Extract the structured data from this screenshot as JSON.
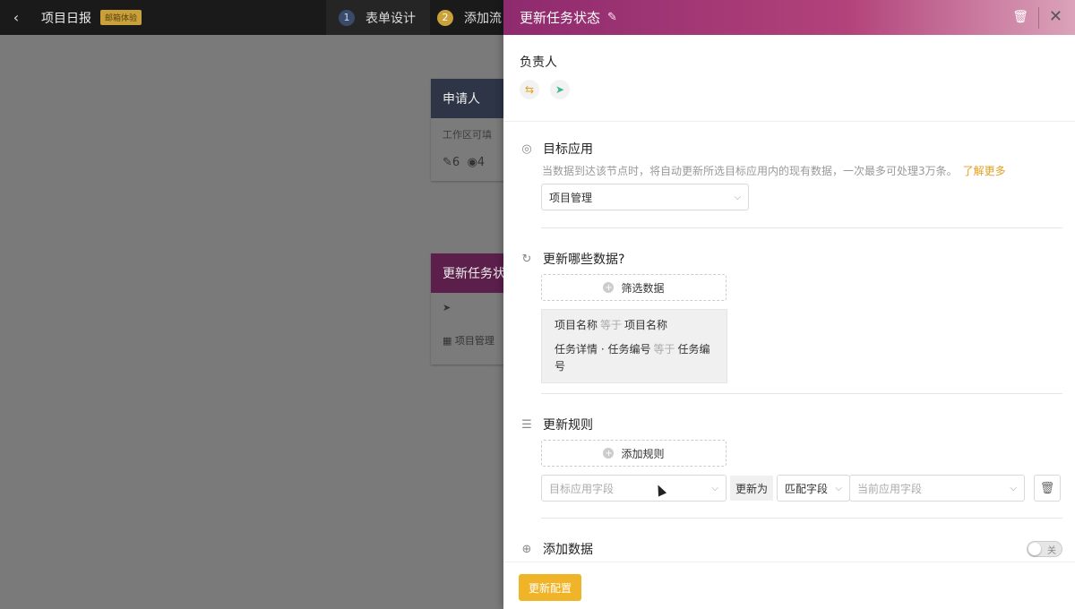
{
  "topbar": {
    "back_icon": "chevron-left-icon",
    "app_title": "项目日报",
    "badge": "邮箱体验",
    "step1": {
      "num": "1",
      "label": "表单设计"
    },
    "step2": {
      "num": "2",
      "label": "添加流"
    }
  },
  "canvas": {
    "node1": {
      "title": "申请人",
      "desc": "工作区可填",
      "edit_count": "6",
      "view_count": "4"
    },
    "node2": {
      "title": "更新任务状",
      "app": "项目管理"
    }
  },
  "drawer": {
    "title": "更新任务状态",
    "owner": {
      "label": "负责人"
    },
    "target_app": {
      "title": "目标应用",
      "desc": "当数据到达该节点时，将自动更新所选目标应用内的现有数据，一次最多可处理3万条。",
      "learn_more": "了解更多",
      "selected": "项目管理"
    },
    "which_data": {
      "title": "更新哪些数据?",
      "filter_button": "筛选数据",
      "conditions": [
        {
          "left": "项目名称",
          "op": "等于",
          "right": "项目名称"
        },
        {
          "left": "任务详情 · 任务编号",
          "op": "等于",
          "right": "任务编号"
        }
      ]
    },
    "rules": {
      "title": "更新规则",
      "add_button": "添加规则",
      "target_field_placeholder": "目标应用字段",
      "update_to": "更新为",
      "match_mode": "匹配字段",
      "current_field_placeholder": "当前应用字段"
    },
    "add_data": {
      "title": "添加数据",
      "toggle_label": "关"
    },
    "footer": {
      "save_label": "更新配置"
    }
  }
}
